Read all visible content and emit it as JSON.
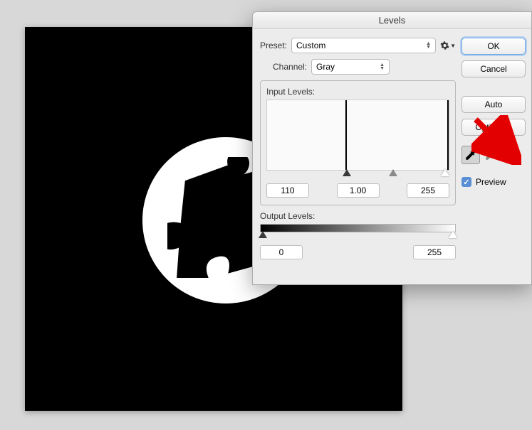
{
  "dialog": {
    "title": "Levels",
    "preset_label": "Preset:",
    "preset_value": "Custom",
    "channel_label": "Channel:",
    "channel_value": "Gray",
    "input_label": "Input Levels:",
    "input_shadows": "110",
    "input_mid": "1.00",
    "input_highlights": "255",
    "output_label": "Output Levels:",
    "output_low": "0",
    "output_high": "255"
  },
  "buttons": {
    "ok": "OK",
    "cancel": "Cancel",
    "auto": "Auto",
    "options": "Options..."
  },
  "preview": {
    "label": "Preview"
  }
}
